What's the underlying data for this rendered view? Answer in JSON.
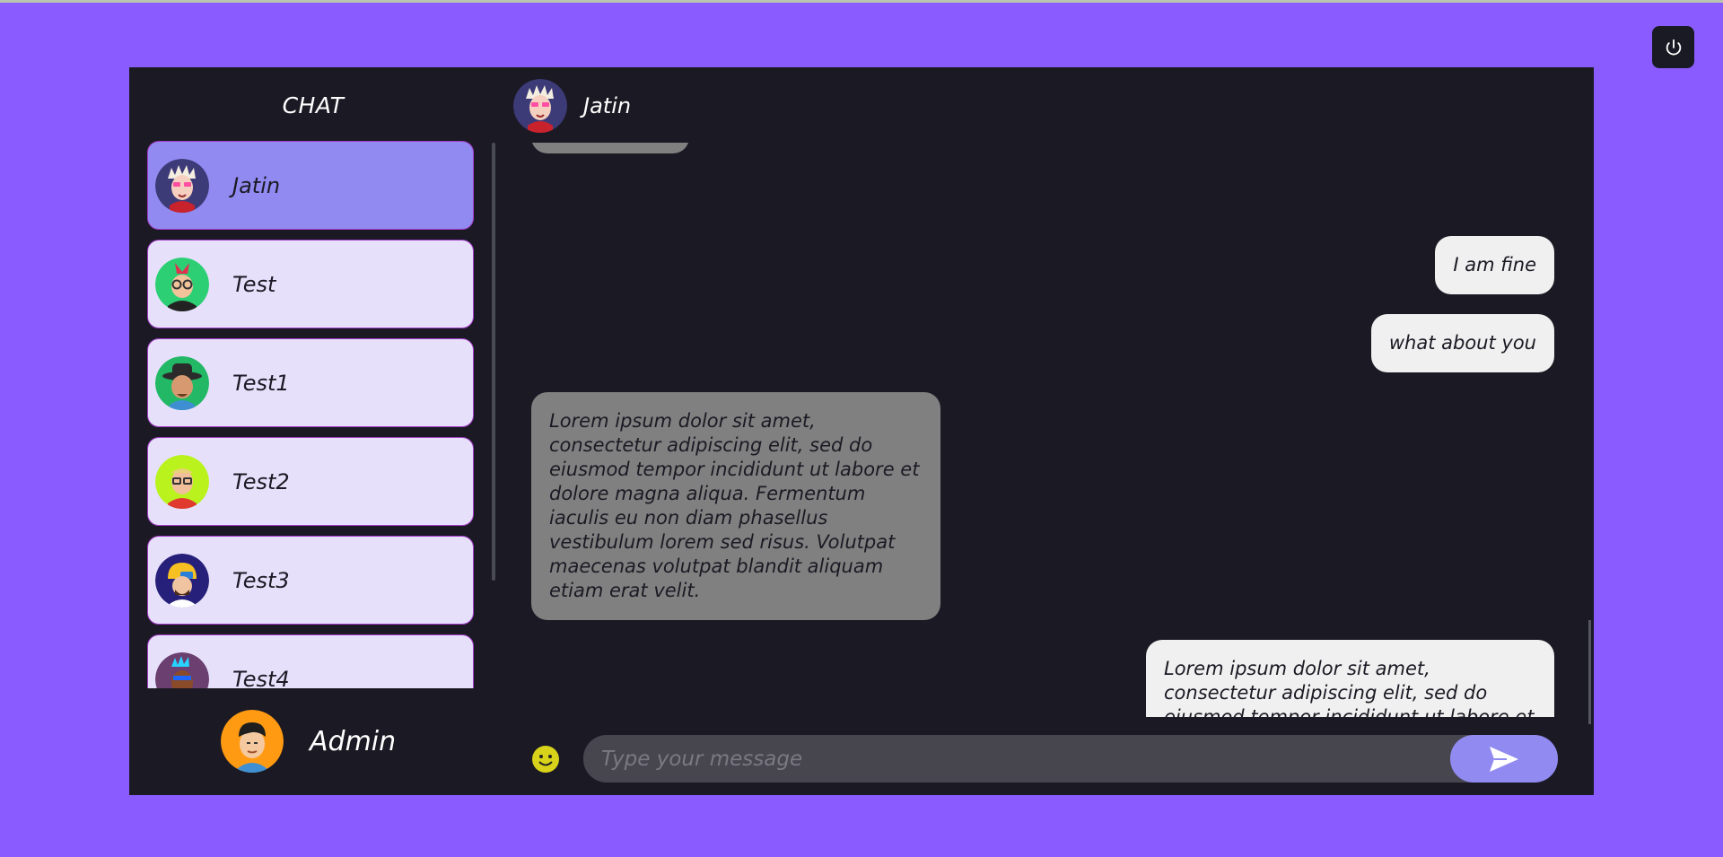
{
  "sidebar": {
    "title": "CHAT",
    "contacts": [
      {
        "name": "Jatin",
        "avatar": "spiky-hair-avatar"
      },
      {
        "name": "Test",
        "avatar": "mohawk-avatar"
      },
      {
        "name": "Test1",
        "avatar": "hat-avatar"
      },
      {
        "name": "Test2",
        "avatar": "glasses-avatar"
      },
      {
        "name": "Test3",
        "avatar": "helmet-avatar"
      },
      {
        "name": "Test4",
        "avatar": "blue-hair-avatar"
      }
    ],
    "active_contact": "Jatin"
  },
  "user": {
    "name": "Admin",
    "avatar": "admin-avatar"
  },
  "chat": {
    "contact_name": "Jatin",
    "messages": [
      {
        "from": "them",
        "text": ""
      },
      {
        "from": "me",
        "text": "I am fine"
      },
      {
        "from": "me",
        "text": "what about you"
      },
      {
        "from": "them",
        "text": "Lorem ipsum dolor sit amet, consectetur adipiscing elit, sed do eiusmod tempor incididunt ut labore et dolore magna aliqua. Fermentum iaculis eu non diam phasellus vestibulum lorem sed risus. Volutpat maecenas volutpat blandit aliquam etiam erat velit."
      },
      {
        "from": "me",
        "text": "Lorem ipsum dolor sit amet, consectetur adipiscing elit, sed do eiusmod tempor incididunt ut labore et dolore magna aliqua."
      }
    ]
  },
  "composer": {
    "placeholder": "Type your message",
    "value": ""
  },
  "colors": {
    "page_bg": "#8a5cff",
    "panel_bg": "#1b1a24",
    "active_contact": "#918af0",
    "contact_bg": "#e6e0fb",
    "bubble_them": "#808080",
    "bubble_me": "#f0f0f0"
  },
  "icons": {
    "power": "power-icon",
    "emoji": "smiley-icon",
    "send": "send-icon"
  }
}
